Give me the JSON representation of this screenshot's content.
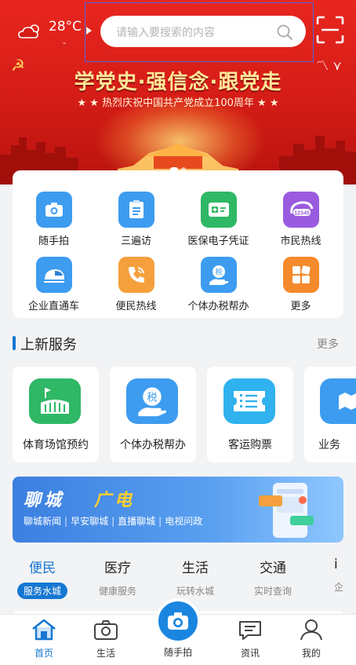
{
  "header": {
    "temperature": "28°C",
    "temperature_sub": "-",
    "search_placeholder": "请输入要搜索的内容"
  },
  "banner": {
    "title": "学党史·强信念·跟党走",
    "subtitle": "★ ★ 热烈庆祝中国共产党成立100周年 ★ ★",
    "page_count": 2,
    "active_page": 1
  },
  "quick_services": [
    {
      "label": "随手拍",
      "icon": "camera-icon",
      "color": "#3d9cf0"
    },
    {
      "label": "三遍访",
      "icon": "checklist-icon",
      "color": "#3d9cf0"
    },
    {
      "label": "医保电子凭证",
      "icon": "medical-card-icon",
      "color": "#2fb865"
    },
    {
      "label": "市民热线",
      "icon": "hotline-12345-icon",
      "color": "#9a5be0"
    },
    {
      "label": "企业直通车",
      "icon": "train-icon",
      "color": "#3d9cf0"
    },
    {
      "label": "便民热线",
      "icon": "phone-icon",
      "color": "#f5a03c"
    },
    {
      "label": "个体办税帮办",
      "icon": "tax-hand-icon",
      "color": "#3d9cf0"
    },
    {
      "label": "更多",
      "icon": "more-grid-icon",
      "color": "#f58a2c"
    }
  ],
  "new_services": {
    "title": "上新服务",
    "more": "更多",
    "items": [
      {
        "label": "体育场馆预约",
        "icon": "stadium-icon",
        "color": "#2fb865"
      },
      {
        "label": "个体办税帮办",
        "icon": "tax-hand-icon",
        "color": "#3d9cf0"
      },
      {
        "label": "客运购票",
        "icon": "ticket-icon",
        "color": "#2fb2ee"
      },
      {
        "label": "业务",
        "icon": "map-icon",
        "color": "#3d9cf0"
      }
    ]
  },
  "ad": {
    "title_white": "聊城",
    "title_yellow": "广电",
    "links": [
      "聊城新闻",
      "早安聊城",
      "直播聊城",
      "电视问政"
    ]
  },
  "categories": [
    {
      "name": "便民",
      "sub": "服务水城",
      "active": true
    },
    {
      "name": "医疗",
      "sub": "健康服务",
      "active": false
    },
    {
      "name": "生活",
      "sub": "玩转水城",
      "active": false
    },
    {
      "name": "交通",
      "sub": "实时查询",
      "active": false
    },
    {
      "name": "i",
      "sub": "企",
      "active": false
    }
  ],
  "bottom_nav": {
    "home": "首页",
    "life": "生活",
    "snap": "随手拍",
    "news": "资讯",
    "mine": "我的"
  },
  "colors": {
    "primary": "#1677d2",
    "banner_red": "#d41c16",
    "fab_blue": "#1a86e0"
  }
}
